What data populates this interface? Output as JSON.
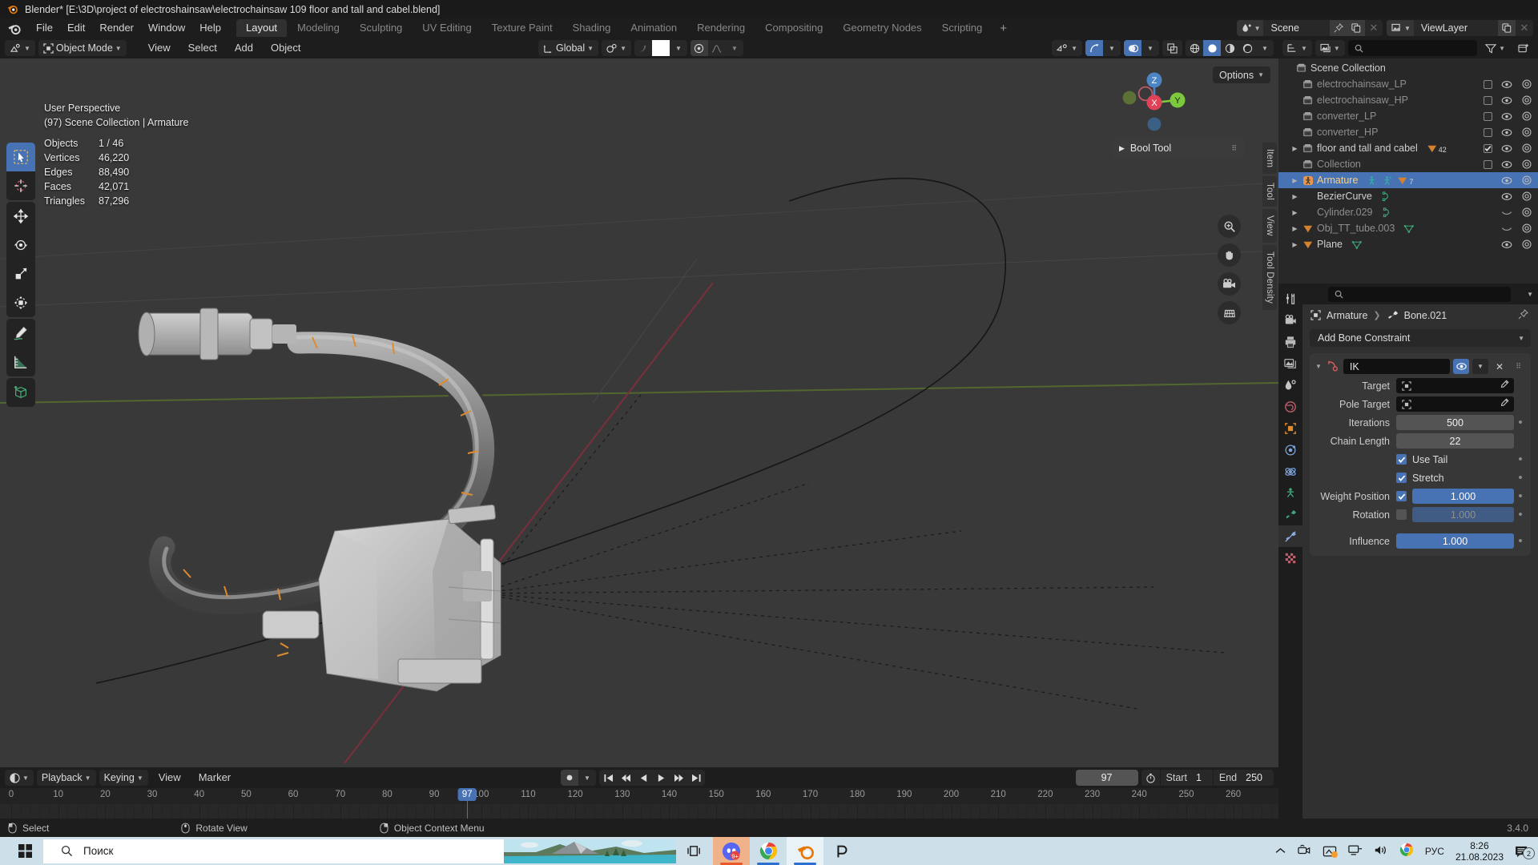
{
  "window": {
    "title": "Blender* [E:\\3D\\project of electroshainsaw\\electrochainsaw 109 floor and tall and cabel.blend]"
  },
  "topbar": {
    "menus": [
      "File",
      "Edit",
      "Render",
      "Window",
      "Help"
    ],
    "workspaces": [
      {
        "label": "Layout",
        "active": true
      },
      {
        "label": "Modeling",
        "active": false
      },
      {
        "label": "Sculpting",
        "active": false
      },
      {
        "label": "UV Editing",
        "active": false
      },
      {
        "label": "Texture Paint",
        "active": false
      },
      {
        "label": "Shading",
        "active": false
      },
      {
        "label": "Animation",
        "active": false
      },
      {
        "label": "Rendering",
        "active": false
      },
      {
        "label": "Compositing",
        "active": false
      },
      {
        "label": "Geometry Nodes",
        "active": false
      },
      {
        "label": "Scripting",
        "active": false
      }
    ],
    "add_workspace": "+",
    "scene_name": "Scene",
    "viewlayer_name": "ViewLayer"
  },
  "viewport_header": {
    "mode": "Object Mode",
    "menus": [
      "View",
      "Select",
      "Add",
      "Object"
    ],
    "transform_orientation": "Global",
    "options_label": "Options"
  },
  "viewport": {
    "perspective": "User Perspective",
    "scene_info": "(97) Scene Collection | Armature",
    "stats": [
      {
        "key": "Objects",
        "value": "1 / 46"
      },
      {
        "key": "Vertices",
        "value": "46,220"
      },
      {
        "key": "Edges",
        "value": "88,490"
      },
      {
        "key": "Faces",
        "value": "42,071"
      },
      {
        "key": "Triangles",
        "value": "87,296"
      }
    ],
    "gizmo_axes": [
      "Z",
      "Y",
      "X"
    ],
    "npanel": {
      "title": "Bool Tool"
    },
    "ntabs": [
      "Item",
      "Tool",
      "View",
      "Tool Density"
    ]
  },
  "outliner": {
    "root": "Scene Collection",
    "rows": [
      {
        "name": "electrochainsaw_LP",
        "icon": "collection-icon",
        "dim": true,
        "expand": false,
        "checkbox": "unchecked",
        "eye": true,
        "camera": true,
        "badges": []
      },
      {
        "name": "electrochainsaw_HP",
        "icon": "collection-icon",
        "dim": true,
        "expand": false,
        "checkbox": "unchecked",
        "eye": true,
        "camera": true,
        "badges": []
      },
      {
        "name": "converter_LP",
        "icon": "collection-icon",
        "dim": true,
        "expand": false,
        "checkbox": "unchecked",
        "eye": true,
        "camera": true,
        "badges": []
      },
      {
        "name": "converter_HP",
        "icon": "collection-icon",
        "dim": true,
        "expand": false,
        "checkbox": "unchecked",
        "eye": true,
        "camera": true,
        "badges": []
      },
      {
        "name": "floor and tall and cabel",
        "icon": "collection-icon",
        "dim": false,
        "expand": true,
        "checkbox": "checked",
        "eye": true,
        "camera": true,
        "badges": [
          {
            "type": "mesh-data-icon",
            "count": "42"
          }
        ]
      },
      {
        "name": "Collection",
        "icon": "collection-icon",
        "dim": true,
        "expand": false,
        "checkbox": "unchecked",
        "eye": true,
        "camera": true,
        "badges": []
      },
      {
        "name": "Armature",
        "icon": "armature-icon",
        "dim": false,
        "expand": true,
        "selected": true,
        "eye": true,
        "camera": true,
        "badges": [
          {
            "type": "pose-icon",
            "count": ""
          },
          {
            "type": "armature-data-icon",
            "count": ""
          },
          {
            "type": "mesh-data-icon",
            "count": "7"
          }
        ]
      },
      {
        "name": "BezierCurve",
        "icon": "curve-icon",
        "dim": false,
        "expand": true,
        "eye": true,
        "camera": true,
        "badges": [
          {
            "type": "curve-data-icon",
            "count": ""
          }
        ]
      },
      {
        "name": "Cylinder.029",
        "icon": "curve-icon",
        "dim": true,
        "expand": true,
        "eye": false,
        "camera": true,
        "badges": [
          {
            "type": "curve-data-icon",
            "count": ""
          }
        ]
      },
      {
        "name": "Obj_TT_tube.003",
        "icon": "mesh-icon",
        "dim": true,
        "expand": true,
        "eye": false,
        "camera": true,
        "badges": [
          {
            "type": "mesh-data-icon-green",
            "count": ""
          }
        ]
      },
      {
        "name": "Plane",
        "icon": "mesh-icon",
        "dim": false,
        "expand": true,
        "eye": true,
        "camera": true,
        "badges": [
          {
            "type": "mesh-data-icon-green",
            "count": ""
          }
        ]
      }
    ]
  },
  "properties": {
    "breadcrumb": {
      "object": "Armature",
      "bone": "Bone.021"
    },
    "add_constraint_label": "Add Bone Constraint",
    "constraint": {
      "name": "IK",
      "fields": [
        {
          "label": "Target",
          "type": "object-field",
          "value": ""
        },
        {
          "label": "Pole Target",
          "type": "object-field",
          "value": ""
        },
        {
          "label": "Iterations",
          "type": "number",
          "value": "500"
        },
        {
          "label": "Chain Length",
          "type": "number",
          "value": "22"
        }
      ],
      "toggles": [
        {
          "label": "Use Tail",
          "checked": true
        },
        {
          "label": "Stretch",
          "checked": true
        }
      ],
      "weighted": [
        {
          "label": "Weight Position",
          "checked": true,
          "value": "1.000",
          "enabled": true
        },
        {
          "label": "Rotation",
          "checked": false,
          "value": "1.000",
          "enabled": false
        }
      ],
      "influence": {
        "label": "Influence",
        "value": "1.000"
      }
    }
  },
  "timeline": {
    "menus": [
      "Playback",
      "Keying",
      "View",
      "Marker"
    ],
    "current_frame": "97",
    "start_label": "Start",
    "start_value": "1",
    "end_label": "End",
    "end_value": "250",
    "ticks": [
      "0",
      "10",
      "20",
      "30",
      "40",
      "50",
      "60",
      "70",
      "80",
      "90",
      "100",
      "110",
      "120",
      "130",
      "140",
      "150",
      "160",
      "170",
      "180",
      "190",
      "200",
      "210",
      "220",
      "230",
      "240",
      "250",
      "260"
    ]
  },
  "statusbar": {
    "items": [
      {
        "icon": "mouse-left-icon",
        "label": "Select"
      },
      {
        "icon": "mouse-middle-icon",
        "label": "Rotate View"
      },
      {
        "icon": "mouse-right-icon",
        "label": "Object Context Menu"
      }
    ],
    "version": "3.4.0"
  },
  "taskbar": {
    "search_placeholder": "Поиск",
    "apps": [
      "task-view-icon",
      "discord-icon",
      "chrome-icon",
      "blender-icon",
      "substance-painter-icon"
    ],
    "language": "РУС",
    "time": "8:26",
    "date": "21.08.2023",
    "notification_count": "2"
  },
  "colors": {
    "accent_blue": "#4772b3",
    "outliner_selected": "#4772b3",
    "orange_text": "#ffcf7f",
    "viewport_bg": "#393939",
    "panel_bg": "#303030"
  }
}
